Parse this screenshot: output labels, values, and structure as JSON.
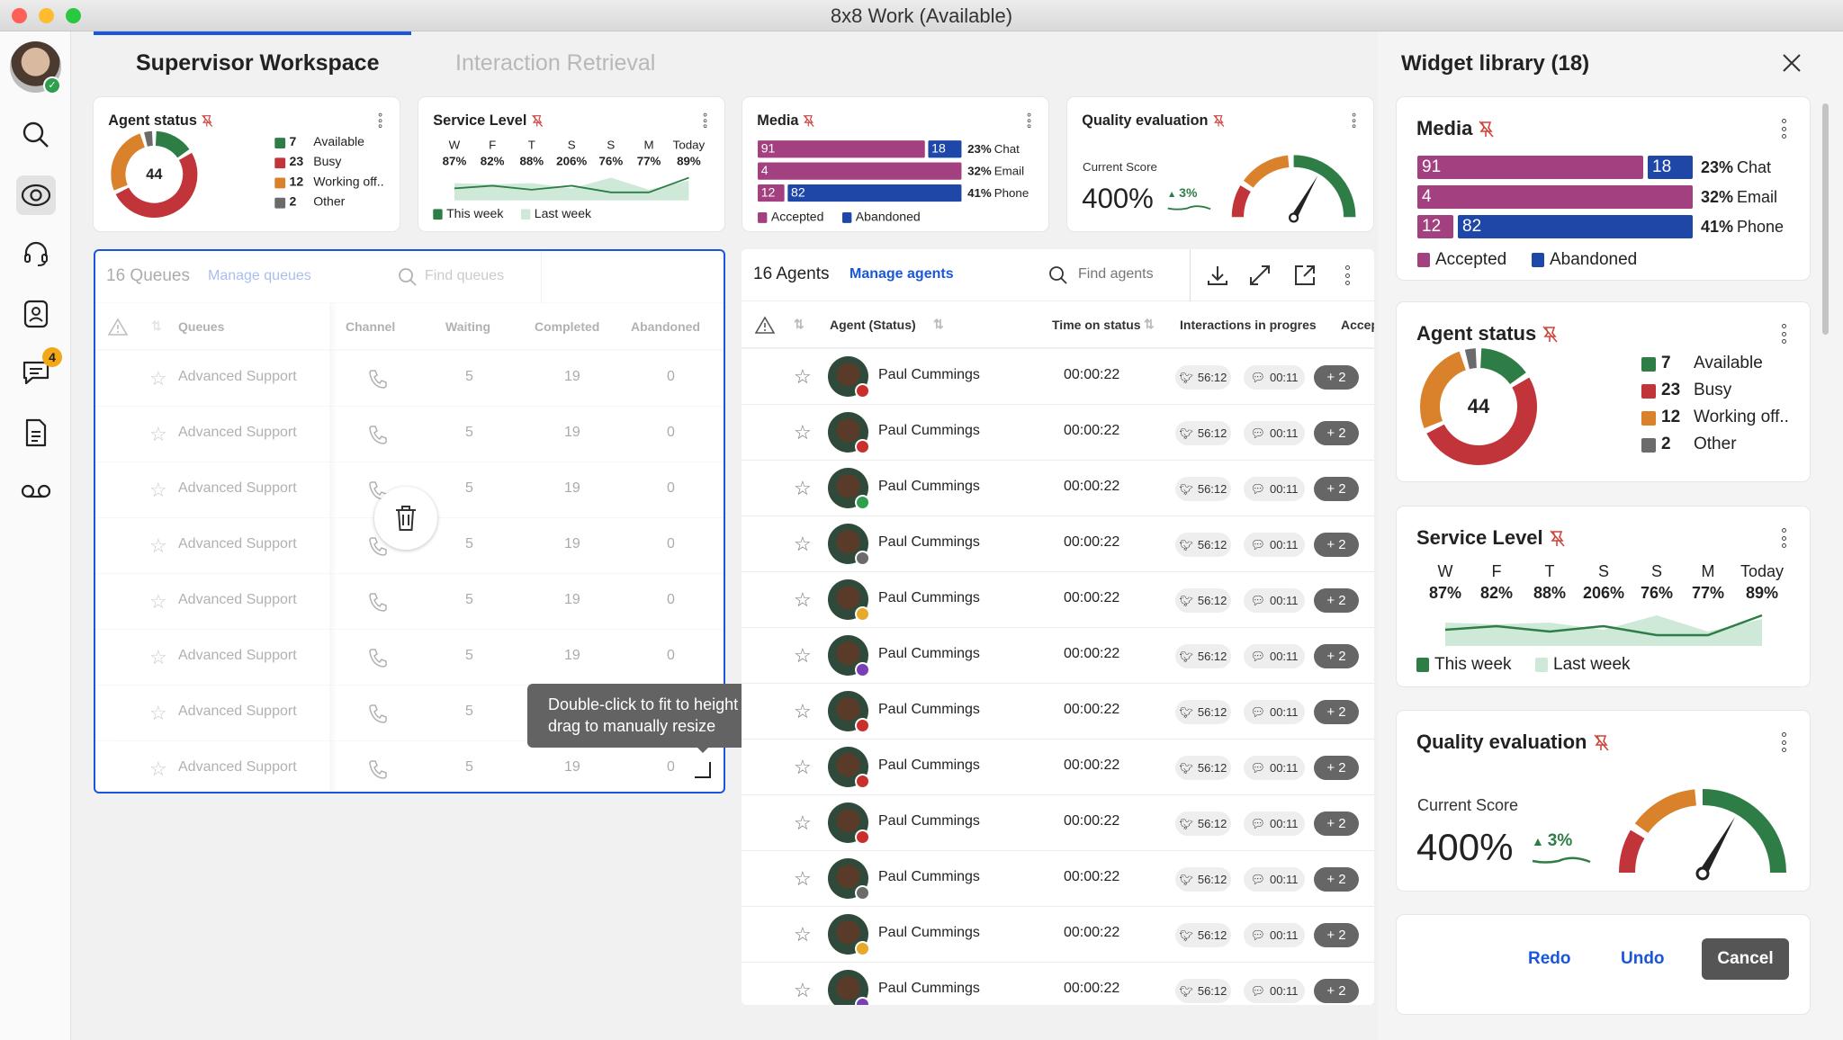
{
  "window": {
    "title": "8x8 Work (Available)"
  },
  "tabs": [
    {
      "label": "Supervisor Workspace",
      "active": true
    },
    {
      "label": "Interaction Retrieval",
      "active": false
    }
  ],
  "sidebar": {
    "chat_badge": "4",
    "items": [
      "search",
      "monitoring",
      "headset",
      "contacts",
      "messages",
      "documents",
      "voicemail"
    ]
  },
  "widgets": {
    "agent_status": {
      "title": "Agent status",
      "total": "44",
      "items": [
        {
          "count": "7",
          "label": "Available",
          "color": "#2e7d46"
        },
        {
          "count": "23",
          "label": "Busy",
          "color": "#c0343a"
        },
        {
          "count": "12",
          "label": "Working off..",
          "color": "#d9822b"
        },
        {
          "count": "2",
          "label": "Other",
          "color": "#6b6b6b"
        }
      ]
    },
    "service_level": {
      "title": "Service Level",
      "days": [
        {
          "day": "W",
          "pct": "87%"
        },
        {
          "day": "F",
          "pct": "82%"
        },
        {
          "day": "T",
          "pct": "88%"
        },
        {
          "day": "S",
          "pct": "206%"
        },
        {
          "day": "S",
          "pct": "76%"
        },
        {
          "day": "M",
          "pct": "77%"
        },
        {
          "day": "Today",
          "pct": "89%"
        }
      ],
      "legend": [
        "This week",
        "Last week"
      ],
      "colors": {
        "this_week": "#2e7d46",
        "last_week": "#cfe9d8"
      }
    },
    "media": {
      "title": "Media",
      "rows": [
        {
          "accepted": "91",
          "abandoned": "18",
          "pct": "23%",
          "channel": "Chat"
        },
        {
          "accepted": "4",
          "abandoned": "",
          "pct": "32%",
          "channel": "Email"
        },
        {
          "accepted": "12",
          "abandoned": "82",
          "pct": "41%",
          "channel": "Phone"
        }
      ],
      "legend": [
        "Accepted",
        "Abandoned"
      ],
      "colors": {
        "accepted": "#a3407f",
        "abandoned": "#1f47a8"
      }
    },
    "quality": {
      "title": "Quality evaluation",
      "label": "Current Score",
      "score": "400%",
      "change": "3%"
    }
  },
  "chart_data": [
    {
      "type": "line",
      "title": "Service Level",
      "categories": [
        "W",
        "F",
        "T",
        "S",
        "S",
        "M",
        "Today"
      ],
      "series": [
        {
          "name": "This week",
          "values": [
            45,
            55,
            40,
            55,
            30,
            30,
            85
          ]
        },
        {
          "name": "Last week",
          "values": [
            65,
            60,
            65,
            45,
            85,
            40,
            75
          ]
        }
      ]
    }
  ],
  "queues": {
    "count_label": "16 Queues",
    "manage_label": "Manage queues",
    "search_placeholder": "Find queues",
    "columns": [
      "Queues",
      "Channel",
      "Waiting",
      "Completed",
      "Abandoned"
    ],
    "rows": [
      {
        "name": "Advanced Support",
        "waiting": "5",
        "completed": "19",
        "abandoned": "0"
      },
      {
        "name": "Advanced Support",
        "waiting": "5",
        "completed": "19",
        "abandoned": "0"
      },
      {
        "name": "Advanced Support",
        "waiting": "5",
        "completed": "19",
        "abandoned": "0"
      },
      {
        "name": "Advanced Support",
        "waiting": "5",
        "completed": "19",
        "abandoned": "0"
      },
      {
        "name": "Advanced Support",
        "waiting": "5",
        "completed": "19",
        "abandoned": "0"
      },
      {
        "name": "Advanced Support",
        "waiting": "5",
        "completed": "19",
        "abandoned": "0"
      },
      {
        "name": "Advanced Support",
        "waiting": "5",
        "completed": "19",
        "abandoned": "0"
      },
      {
        "name": "Advanced Support",
        "waiting": "5",
        "completed": "19",
        "abandoned": "0"
      }
    ]
  },
  "agents": {
    "count_label": "16 Agents",
    "manage_label": "Manage agents",
    "search_placeholder": "Find agents",
    "columns": [
      "Agent (Status)",
      "Time on status",
      "Interactions in progres",
      "Accep"
    ],
    "rows": [
      {
        "name": "Paul Cummings",
        "time": "00:00:22",
        "twitter": "56:12",
        "chat": "00:11",
        "more": "+ 2",
        "status": "#c9302c"
      },
      {
        "name": "Paul Cummings",
        "time": "00:00:22",
        "twitter": "56:12",
        "chat": "00:11",
        "more": "+ 2",
        "status": "#c9302c"
      },
      {
        "name": "Paul Cummings",
        "time": "00:00:22",
        "twitter": "56:12",
        "chat": "00:11",
        "more": "+ 2",
        "status": "#2e9e4f"
      },
      {
        "name": "Paul Cummings",
        "time": "00:00:22",
        "twitter": "56:12",
        "chat": "00:11",
        "more": "+ 2",
        "status": "#6b6b6b"
      },
      {
        "name": "Paul Cummings",
        "time": "00:00:22",
        "twitter": "56:12",
        "chat": "00:11",
        "more": "+ 2",
        "status": "#e6a92a"
      },
      {
        "name": "Paul Cummings",
        "time": "00:00:22",
        "twitter": "56:12",
        "chat": "00:11",
        "more": "+ 2",
        "status": "#7b3fb5"
      },
      {
        "name": "Paul Cummings",
        "time": "00:00:22",
        "twitter": "56:12",
        "chat": "00:11",
        "more": "+ 2",
        "status": "#c9302c"
      },
      {
        "name": "Paul Cummings",
        "time": "00:00:22",
        "twitter": "56:12",
        "chat": "00:11",
        "more": "+ 2",
        "status": "#c9302c"
      },
      {
        "name": "Paul Cummings",
        "time": "00:00:22",
        "twitter": "56:12",
        "chat": "00:11",
        "more": "+ 2",
        "status": "#c9302c"
      },
      {
        "name": "Paul Cummings",
        "time": "00:00:22",
        "twitter": "56:12",
        "chat": "00:11",
        "more": "+ 2",
        "status": "#6b6b6b"
      },
      {
        "name": "Paul Cummings",
        "time": "00:00:22",
        "twitter": "56:12",
        "chat": "00:11",
        "more": "+ 2",
        "status": "#e6a92a"
      },
      {
        "name": "Paul Cummings",
        "time": "00:00:22",
        "twitter": "56:12",
        "chat": "00:11",
        "more": "+ 2",
        "status": "#7b3fb5"
      }
    ]
  },
  "tooltip": "Double-click to fit to height or click and drag to manually resize",
  "library": {
    "title": "Widget library (18)",
    "redo": "Redo",
    "undo": "Undo",
    "cancel": "Cancel"
  }
}
